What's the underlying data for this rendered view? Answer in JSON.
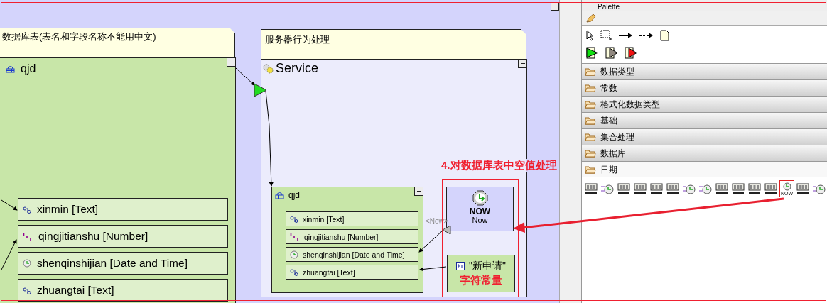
{
  "canvas": {
    "notes": [
      {
        "text": "数据库表(表名和字段名称不能用中文)"
      },
      {
        "text": "服务器行为处理"
      }
    ],
    "source_table": {
      "name": "qjd",
      "fields": [
        {
          "name": "xinmin [Text]",
          "kind": "text"
        },
        {
          "name": "qingjitianshu [Number]",
          "kind": "number"
        },
        {
          "name": "shenqinshijian [Date and Time]",
          "kind": "datetime"
        },
        {
          "name": "zhuangtai [Text]",
          "kind": "text"
        }
      ]
    },
    "service": {
      "title": "Service",
      "table": {
        "name": "qjd",
        "fields": [
          {
            "name": "xinmin [Text]",
            "kind": "text"
          },
          {
            "name": "qingjitianshu [Number]",
            "kind": "number"
          },
          {
            "name": "shenqinshijian [Date and Time]",
            "kind": "datetime"
          },
          {
            "name": "zhuangtai [Text]",
            "kind": "text"
          }
        ]
      },
      "now_node": {
        "title": "NOW",
        "subtitle": "Now",
        "port_label": "<Now>"
      },
      "constant_node": {
        "value": "\"新申请\"",
        "annotation": "字符常量"
      }
    },
    "annotation": {
      "text": "4.对数据库表中空值处理"
    }
  },
  "palette": {
    "title": "Palette",
    "drawers": [
      {
        "label": "数据类型",
        "expanded": false
      },
      {
        "label": "常数",
        "expanded": false
      },
      {
        "label": "格式化数据类型",
        "expanded": false
      },
      {
        "label": "基础",
        "expanded": false
      },
      {
        "label": "集合处理",
        "expanded": false
      },
      {
        "label": "数据库",
        "expanded": false
      },
      {
        "label": "日期",
        "expanded": true
      }
    ],
    "date_tools": [
      {
        "kind": "calendar",
        "selected": false
      },
      {
        "kind": "clock",
        "selected": false
      },
      {
        "kind": "calendar",
        "selected": false
      },
      {
        "kind": "calendar",
        "selected": false
      },
      {
        "kind": "calendar",
        "selected": false
      },
      {
        "kind": "calendar",
        "selected": false
      },
      {
        "kind": "clock",
        "selected": false
      },
      {
        "kind": "clock",
        "selected": false
      },
      {
        "kind": "calendar",
        "selected": false
      },
      {
        "kind": "calendar",
        "selected": false
      },
      {
        "kind": "calendar",
        "selected": false
      },
      {
        "kind": "calendar",
        "selected": false
      },
      {
        "kind": "now",
        "label": "NOW",
        "selected": true
      },
      {
        "kind": "calendar",
        "selected": false
      },
      {
        "kind": "clock",
        "selected": false
      }
    ]
  }
}
